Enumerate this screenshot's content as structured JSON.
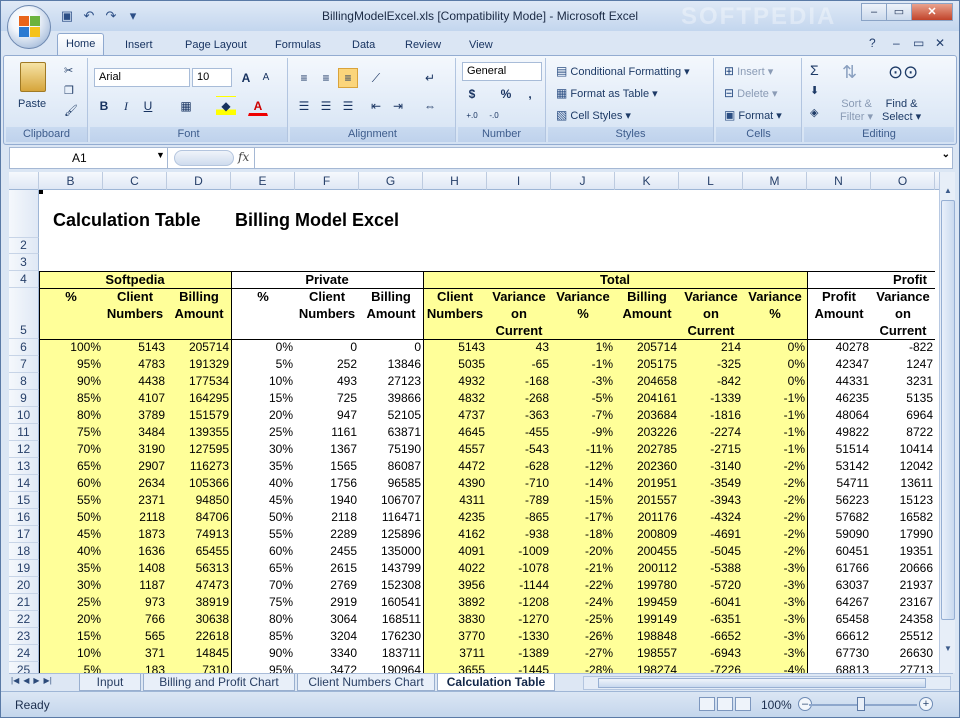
{
  "window": {
    "title": "BillingModelExcel.xls  [Compatibility Mode] - Microsoft Excel",
    "controls": {
      "minimize": "–",
      "restore": "▭",
      "close": "✕"
    }
  },
  "qat": {
    "save_icon": "save-icon",
    "undo_icon": "undo-icon",
    "redo_icon": "redo-icon"
  },
  "ribbon_tabs": [
    "Home",
    "Insert",
    "Page Layout",
    "Formulas",
    "Data",
    "Review",
    "View"
  ],
  "ribbon": {
    "clipboard": {
      "paste": "Paste",
      "label": "Clipboard"
    },
    "font": {
      "name": "Arial",
      "size": "10",
      "label": "Font",
      "bold": "B",
      "italic": "I",
      "underline": "U",
      "grow": "A",
      "shrink": "A",
      "color": "A"
    },
    "alignment": {
      "label": "Alignment"
    },
    "number": {
      "format": "General",
      "currency": "$",
      "percent": "%",
      "comma": ",",
      "inc": "+.0",
      "dec": "-.0",
      "label": "Number"
    },
    "styles": {
      "conditional": "Conditional Formatting",
      "table": "Format as Table",
      "cell": "Cell Styles",
      "label": "Styles"
    },
    "cells": {
      "insert": "Insert",
      "delete": "Delete",
      "format": "Format",
      "label": "Cells"
    },
    "editing": {
      "sum": "Σ",
      "sort": "Sort &",
      "sort2": "Filter",
      "find": "Find &",
      "find2": "Select",
      "label": "Editing"
    }
  },
  "formula_bar": {
    "name_box": "A1",
    "fx": "fx",
    "formula": ""
  },
  "sheet": {
    "columns": [
      "",
      "B",
      "C",
      "D",
      "E",
      "F",
      "G",
      "H",
      "I",
      "J",
      "K",
      "L",
      "M",
      "N",
      "O"
    ],
    "row_numbers": [
      "",
      "2",
      "3",
      "4",
      "5",
      "6",
      "7",
      "8",
      "9",
      "10",
      "11",
      "12",
      "13",
      "14",
      "15",
      "16",
      "17",
      "18",
      "19",
      "20",
      "21",
      "22",
      "23",
      "24",
      "25"
    ],
    "title_left": "Calculation Table",
    "title_right": "Billing Model Excel",
    "group_headers": {
      "softpedia": "Softpedia",
      "private": "Private",
      "total": "Total",
      "profit": "Profit"
    },
    "col_headers": {
      "b": "%",
      "c1": "Client",
      "c2": "Numbers",
      "d1": "Billing",
      "d2": "Amount",
      "e": "%",
      "f1": "Client",
      "f2": "Numbers",
      "g1": "Billing",
      "g2": "Amount",
      "h1": "Client",
      "h2": "Numbers",
      "i1": "Variance",
      "i2": "on",
      "i3": "Current",
      "j1": "Variance",
      "j2": "%",
      "k1": "Billing",
      "k2": "Amount",
      "l1": "Variance",
      "l2": "on",
      "l3": "Current",
      "m1": "Variance",
      "m2": "%",
      "n1": "Profit",
      "n2": "Amount",
      "o1": "Variance",
      "o2": "on",
      "o3": "Current"
    },
    "rows": [
      [
        "100%",
        "5143",
        "205714",
        "0%",
        "0",
        "0",
        "5143",
        "43",
        "1%",
        "205714",
        "214",
        "0%",
        "40278",
        "-822"
      ],
      [
        "95%",
        "4783",
        "191329",
        "5%",
        "252",
        "13846",
        "5035",
        "-65",
        "-1%",
        "205175",
        "-325",
        "0%",
        "42347",
        "1247"
      ],
      [
        "90%",
        "4438",
        "177534",
        "10%",
        "493",
        "27123",
        "4932",
        "-168",
        "-3%",
        "204658",
        "-842",
        "0%",
        "44331",
        "3231"
      ],
      [
        "85%",
        "4107",
        "164295",
        "15%",
        "725",
        "39866",
        "4832",
        "-268",
        "-5%",
        "204161",
        "-1339",
        "-1%",
        "46235",
        "5135"
      ],
      [
        "80%",
        "3789",
        "151579",
        "20%",
        "947",
        "52105",
        "4737",
        "-363",
        "-7%",
        "203684",
        "-1816",
        "-1%",
        "48064",
        "6964"
      ],
      [
        "75%",
        "3484",
        "139355",
        "25%",
        "1161",
        "63871",
        "4645",
        "-455",
        "-9%",
        "203226",
        "-2274",
        "-1%",
        "49822",
        "8722"
      ],
      [
        "70%",
        "3190",
        "127595",
        "30%",
        "1367",
        "75190",
        "4557",
        "-543",
        "-11%",
        "202785",
        "-2715",
        "-1%",
        "51514",
        "10414"
      ],
      [
        "65%",
        "2907",
        "116273",
        "35%",
        "1565",
        "86087",
        "4472",
        "-628",
        "-12%",
        "202360",
        "-3140",
        "-2%",
        "53142",
        "12042"
      ],
      [
        "60%",
        "2634",
        "105366",
        "40%",
        "1756",
        "96585",
        "4390",
        "-710",
        "-14%",
        "201951",
        "-3549",
        "-2%",
        "54711",
        "13611"
      ],
      [
        "55%",
        "2371",
        "94850",
        "45%",
        "1940",
        "106707",
        "4311",
        "-789",
        "-15%",
        "201557",
        "-3943",
        "-2%",
        "56223",
        "15123"
      ],
      [
        "50%",
        "2118",
        "84706",
        "50%",
        "2118",
        "116471",
        "4235",
        "-865",
        "-17%",
        "201176",
        "-4324",
        "-2%",
        "57682",
        "16582"
      ],
      [
        "45%",
        "1873",
        "74913",
        "55%",
        "2289",
        "125896",
        "4162",
        "-938",
        "-18%",
        "200809",
        "-4691",
        "-2%",
        "59090",
        "17990"
      ],
      [
        "40%",
        "1636",
        "65455",
        "60%",
        "2455",
        "135000",
        "4091",
        "-1009",
        "-20%",
        "200455",
        "-5045",
        "-2%",
        "60451",
        "19351"
      ],
      [
        "35%",
        "1408",
        "56313",
        "65%",
        "2615",
        "143799",
        "4022",
        "-1078",
        "-21%",
        "200112",
        "-5388",
        "-3%",
        "61766",
        "20666"
      ],
      [
        "30%",
        "1187",
        "47473",
        "70%",
        "2769",
        "152308",
        "3956",
        "-1144",
        "-22%",
        "199780",
        "-5720",
        "-3%",
        "63037",
        "21937"
      ],
      [
        "25%",
        "973",
        "38919",
        "75%",
        "2919",
        "160541",
        "3892",
        "-1208",
        "-24%",
        "199459",
        "-6041",
        "-3%",
        "64267",
        "23167"
      ],
      [
        "20%",
        "766",
        "30638",
        "80%",
        "3064",
        "168511",
        "3830",
        "-1270",
        "-25%",
        "199149",
        "-6351",
        "-3%",
        "65458",
        "24358"
      ],
      [
        "15%",
        "565",
        "22618",
        "85%",
        "3204",
        "176230",
        "3770",
        "-1330",
        "-26%",
        "198848",
        "-6652",
        "-3%",
        "66612",
        "25512"
      ],
      [
        "10%",
        "371",
        "14845",
        "90%",
        "3340",
        "183711",
        "3711",
        "-1389",
        "-27%",
        "198557",
        "-6943",
        "-3%",
        "67730",
        "26630"
      ],
      [
        "5%",
        "183",
        "7310",
        "95%",
        "3472",
        "190964",
        "3655",
        "-1445",
        "-28%",
        "198274",
        "-7226",
        "-4%",
        "68813",
        "27713"
      ]
    ]
  },
  "sheet_tabs": [
    "Input",
    "Billing and Profit Chart",
    "Client Numbers Chart",
    "Calculation Table"
  ],
  "active_sheet": "Calculation Table",
  "status": {
    "text": "Ready",
    "zoom": "100%"
  },
  "watermark": "SOFTPEDIA"
}
